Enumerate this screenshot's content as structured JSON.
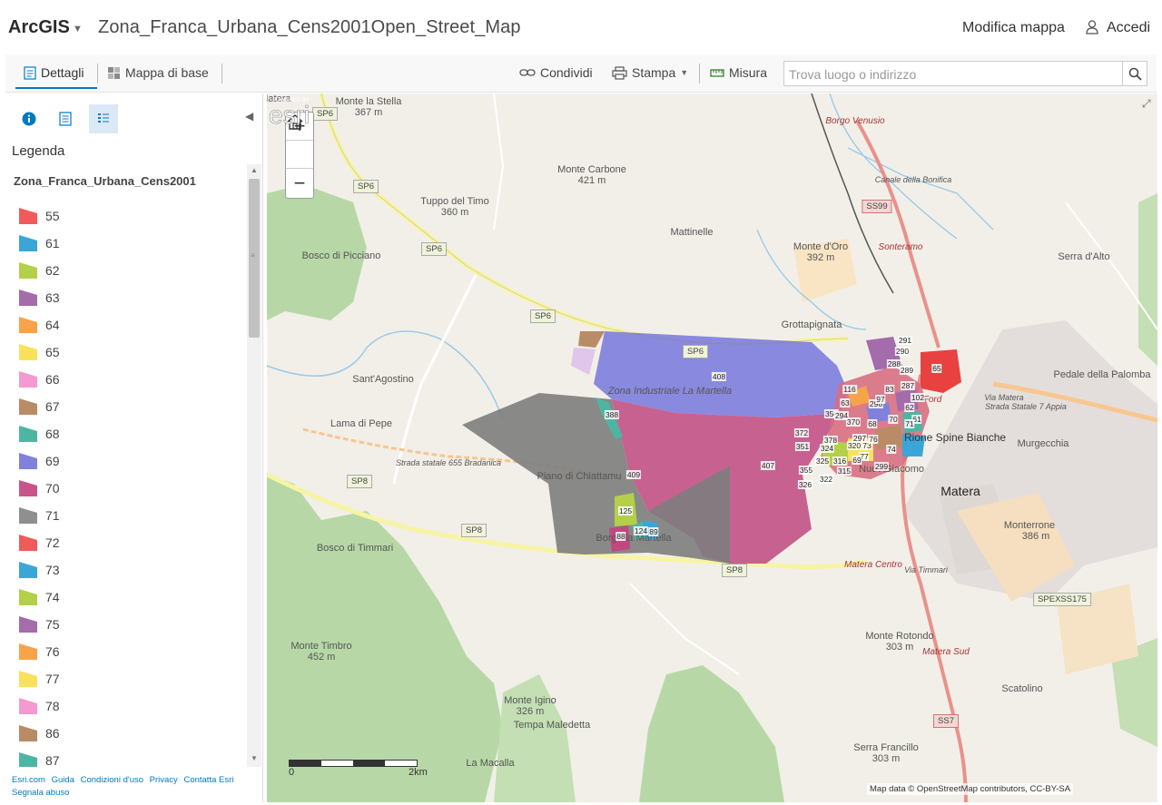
{
  "header": {
    "brand": "ArcGIS",
    "title": "Zona_Franca_Urbana_Cens2001Open_Street_Map",
    "edit_map": "Modifica mappa",
    "sign_in": "Accedi"
  },
  "toolbar": {
    "details": "Dettagli",
    "basemap": "Mappa di base",
    "share": "Condividi",
    "print": "Stampa",
    "measure": "Misura",
    "search_placeholder": "Trova luogo o indirizzo"
  },
  "panel": {
    "legend_title": "Legenda",
    "layer_name": "Zona_Franca_Urbana_Cens2001",
    "legend_items": [
      {
        "label": "55",
        "color": "#f15a5a"
      },
      {
        "label": "61",
        "color": "#3aa6d8"
      },
      {
        "label": "62",
        "color": "#b4cf4a"
      },
      {
        "label": "63",
        "color": "#a46cab"
      },
      {
        "label": "64",
        "color": "#f7a34a"
      },
      {
        "label": "65",
        "color": "#f9e15c"
      },
      {
        "label": "66",
        "color": "#f49ad0"
      },
      {
        "label": "67",
        "color": "#b98b66"
      },
      {
        "label": "68",
        "color": "#4db6a2"
      },
      {
        "label": "69",
        "color": "#8181dc"
      },
      {
        "label": "70",
        "color": "#c9548a"
      },
      {
        "label": "71",
        "color": "#8f8f8f"
      },
      {
        "label": "72",
        "color": "#f15a5a"
      },
      {
        "label": "73",
        "color": "#3aa6d8"
      },
      {
        "label": "74",
        "color": "#b4cf4a"
      },
      {
        "label": "75",
        "color": "#a46cab"
      },
      {
        "label": "76",
        "color": "#f7a34a"
      },
      {
        "label": "77",
        "color": "#f9e15c"
      },
      {
        "label": "78",
        "color": "#f49ad0"
      },
      {
        "label": "86",
        "color": "#b98b66"
      },
      {
        "label": "87",
        "color": "#4db6a2"
      }
    ],
    "footer_links": [
      "Esri.com",
      "Guida",
      "Condizioni d'uso",
      "Privacy",
      "Contatta Esri",
      "Segnala abuso"
    ]
  },
  "map": {
    "zoom_in": "+",
    "zoom_out": "−",
    "scale_start": "0",
    "scale_end": "2km",
    "attribution": "Map data © OpenStreetMap contributors, CC-BY-SA",
    "esri_powered": "POWERED BY",
    "esri_name": "esri",
    "place_labels": [
      "Monte la Stella",
      "367 m",
      "Monte Carbone",
      "421 m",
      "Tuppo del Timo",
      "360 m",
      "Mattinelle",
      "Monte d'Oro",
      "392 m",
      "Serra d'Alto",
      "Grottapignata",
      "Sant'Agostino",
      "Lama di Pepe",
      "Pedale della Palomba",
      "Murgecchia",
      "Rione Spine Bianche",
      "Matera",
      "Monterrone",
      "386 m",
      "Piano di Chiattamu",
      "Borgo la Martella",
      "Bosco di Picciano",
      "Bosco di Timmari",
      "Monte Timbro",
      "452 m",
      "Monte Igino",
      "326 m",
      "Tempa Maledetta",
      "La Macalla",
      "Monte Rotondo",
      "303 m",
      "Scatolino",
      "Serra Francillo",
      "303 m",
      "Zona Industriale La Martella",
      "Borgo Venusio",
      "Sonteramo",
      "Matera Centro",
      "Matera Sud",
      "Canale della Bonifica",
      "Strada Statale 7 Appia",
      "Strada statale 655 Bradanica",
      "Via Matera",
      "Via Timmari",
      "Nuovo",
      "Giacomo",
      "Ford",
      "Via Matera"
    ],
    "road_shields": [
      "SP6",
      "SP6",
      "SP6",
      "SP6",
      "SP8",
      "SP8",
      "SP8",
      "SS99",
      "SS7",
      "SPEXSS175",
      "SP6"
    ],
    "zone_labels": [
      "408",
      "409",
      "407",
      "388",
      "125",
      "88",
      "124",
      "89",
      "291",
      "290",
      "288",
      "289",
      "287",
      "65",
      "116",
      "63",
      "83",
      "102",
      "61",
      "350",
      "298",
      "294",
      "370",
      "68",
      "97",
      "62",
      "70",
      "71",
      "372",
      "378",
      "324",
      "320",
      "73",
      "297",
      "351",
      "77",
      "74",
      "325",
      "316",
      "315",
      "299",
      "355",
      "326",
      "322",
      "76",
      "69"
    ]
  }
}
